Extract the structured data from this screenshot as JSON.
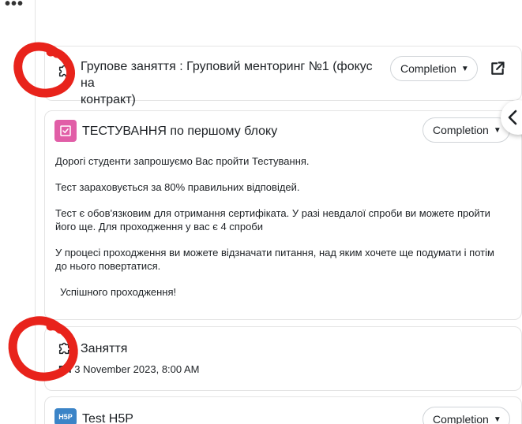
{
  "menu": {
    "more_glyph": "•••"
  },
  "activities": [
    {
      "type": "meeting",
      "icon": "puzzle-icon",
      "title_line1": "Групове заняття : Груповий менторинг №1 (фокус на",
      "title_line2": "контракт)",
      "completion_label": "Completion"
    },
    {
      "type": "quiz",
      "icon": "quiz-icon",
      "title": "ТЕСТУВАННЯ по першому блоку",
      "completion_label": "Completion",
      "description": [
        "Дорогі студенти запрошуємо Вас пройти Тестування.",
        "Тест зараховується за 80% правильних відповідей.",
        "Тест є обов'язковим для отримання сертифіката. У разі невдалої спроби ви можете пройти",
        "його ще. Для проходження у вас є 4 спроби",
        "У процесі проходження ви можете відзначати питання, над яким хочете ще подумати і потім",
        "до нього повертатися.",
        "Успішного проходження!"
      ]
    },
    {
      "type": "meeting",
      "icon": "puzzle-icon",
      "title": "Заняття",
      "date_label": "Fri",
      "date_value": "3 November 2023, 8:00 AM"
    },
    {
      "type": "h5p",
      "icon": "h5p-icon",
      "icon_text": "H5P",
      "title": "Test H5P",
      "completion_label": "Completion"
    }
  ],
  "colors": {
    "quiz_icon": "#e15ea7",
    "h5p_icon": "#3b84c7",
    "annotation_red": "#e8231b"
  }
}
